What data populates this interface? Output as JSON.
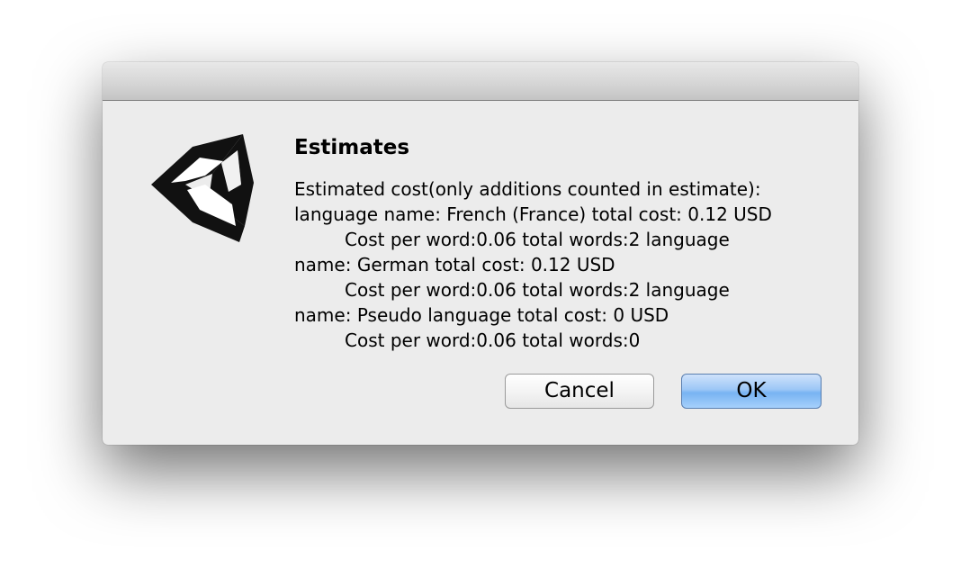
{
  "dialog": {
    "icon": "unity-logo-icon",
    "heading": "Estimates",
    "message_lines": [
      "Estimated cost(only additions counted in estimate):",
      "language name: French (France) total cost: 0.12 USD",
      "Cost per word:0.06 total words:2 language",
      "name: German total cost: 0.12 USD",
      "Cost per word:0.06 total words:2 language",
      "name: Pseudo language total cost: 0 USD",
      "Cost per word:0.06 total words:0"
    ],
    "buttons": {
      "cancel_label": "Cancel",
      "ok_label": "OK"
    }
  },
  "colors": {
    "dialog_bg": "#ececec",
    "ok_button_accent": "#78b3f2"
  }
}
